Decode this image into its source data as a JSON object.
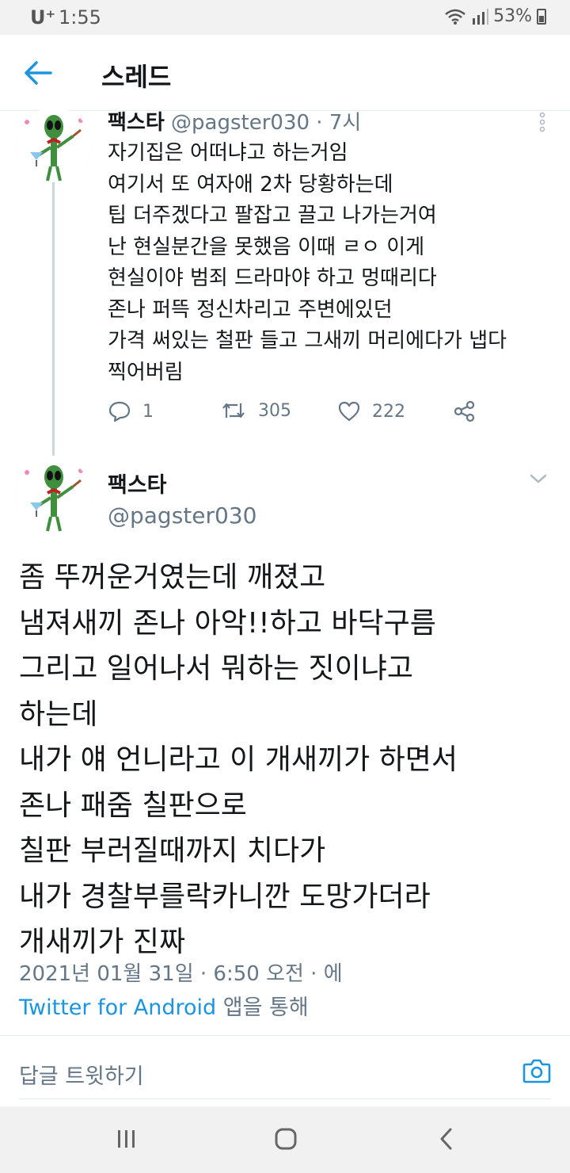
{
  "status_bar": {
    "carrier": "U⁺",
    "time": "1:55",
    "battery": "53%"
  },
  "header": {
    "title": "스레드"
  },
  "parent_tweet": {
    "name": "팩스타",
    "handle": "@pagster030",
    "separator": "·",
    "time_ago": "7시",
    "lines": [
      "자기집은 어떠냐고 하는거임",
      "여기서 또 여자애 2차 당황하는데",
      "팁 더주겠다고 팔잡고 끌고 나가는거여",
      "난 현실분간을 못했음 이때 ㄹㅇ 이게",
      "현실이야 범죄 드라마야 하고 멍때리다",
      "존나 퍼뜩 정신차리고 주변에있던",
      "가격 써있는 철판 들고 그새끼 머리에다가 냅다",
      "찍어버림"
    ],
    "reply_count": "1",
    "retweet_count": "305",
    "like_count": "222"
  },
  "main_tweet": {
    "name": "팩스타",
    "handle": "@pagster030",
    "lines": [
      "좀 뚜꺼운거였는데 깨졌고",
      "냄져새끼 존나 아악!!하고 바닥구름",
      "그리고 일어나서 뭐하는 짓이냐고",
      "하는데",
      "내가 얘 언니라고 이 개새끼가 하면서",
      "존나 패줌 칠판으로",
      "칠판 부러질때까지 치다가",
      "내가 경찰부를락카니깐 도망가더라",
      "개새끼가 진짜"
    ],
    "timestamp": "2021년 01월 31일 · 6:50 오전 · 에",
    "source_link": "Twitter for Android",
    "source_suffix": " 앱을 통해"
  },
  "reply_bar": {
    "placeholder": "답글 트윗하기"
  },
  "colors": {
    "accent": "#1b95e0",
    "secondary_text": "#657786",
    "divider": "#e6ecf0"
  }
}
